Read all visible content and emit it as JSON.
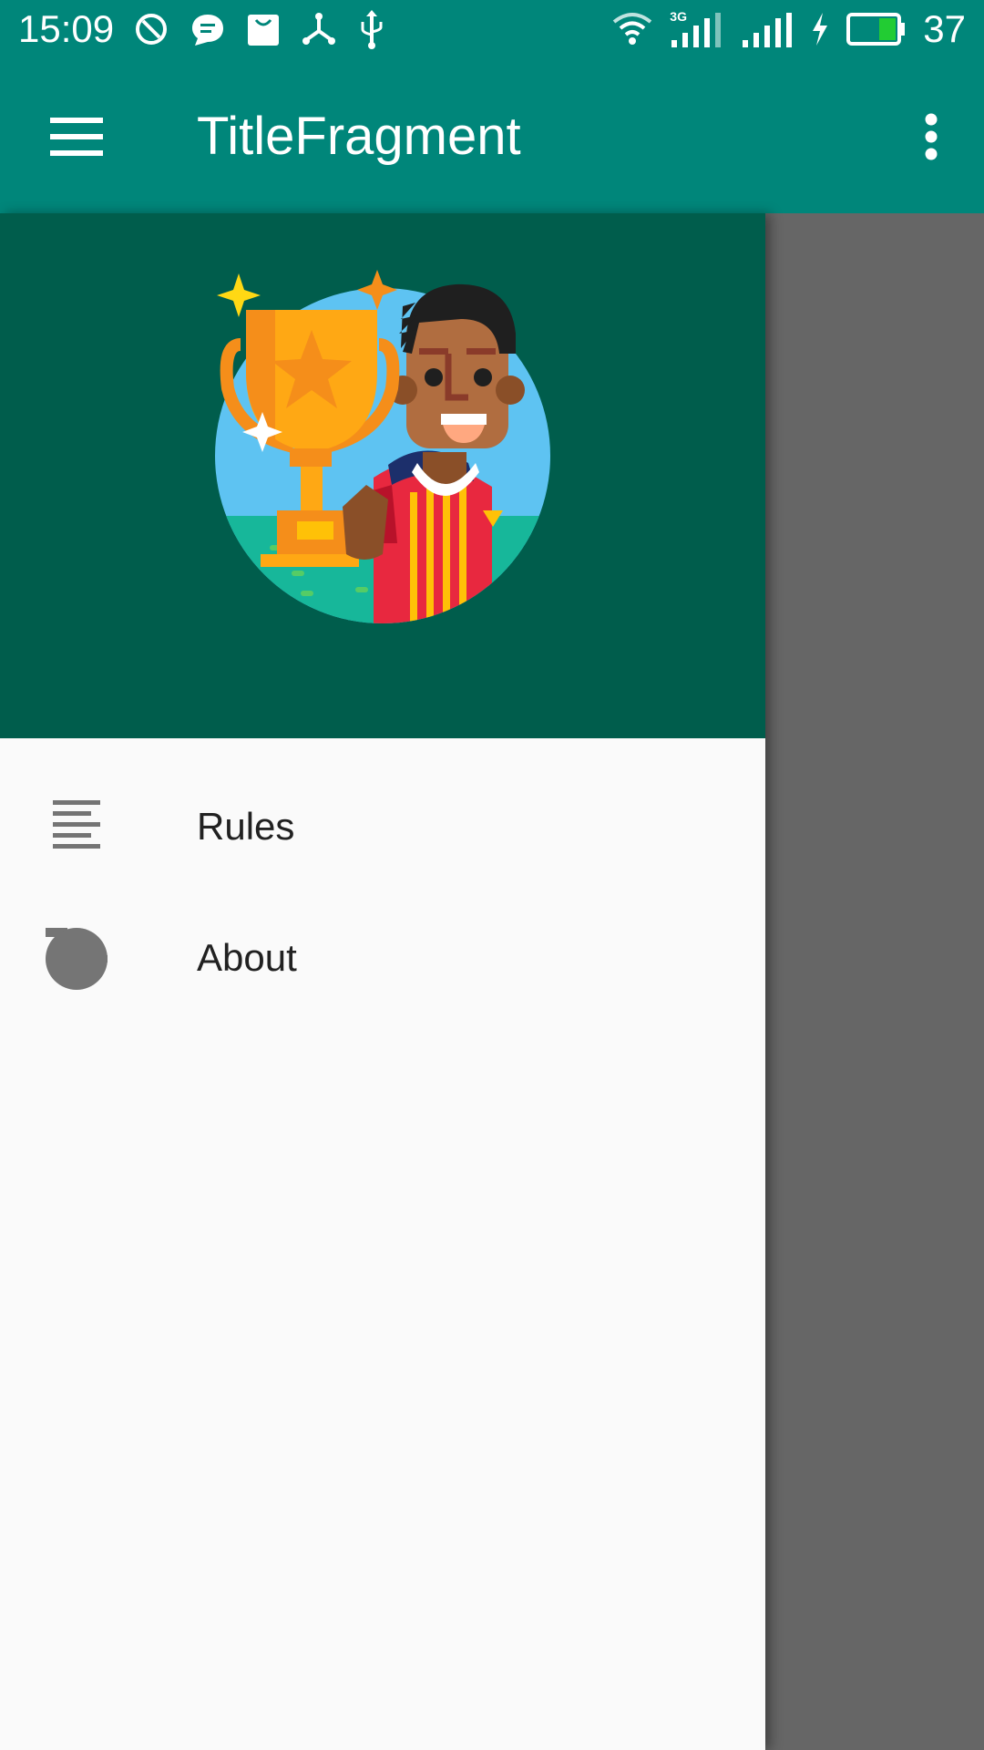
{
  "status_bar": {
    "time": "15:09",
    "battery_level": "37",
    "network_type": "3G",
    "left_icons": [
      "blocked-icon",
      "chat-bubble-icon",
      "shopping-bag-icon",
      "share-nodes-icon",
      "usb-icon"
    ],
    "right_icons": [
      "wifi-icon",
      "signal-3g-icon",
      "signal-icon",
      "charging-icon",
      "battery-icon"
    ],
    "background_color": "#00867a"
  },
  "app_bar": {
    "title": "TitleFragment",
    "background_color": "#00867a",
    "navigation_icon": "hamburger-menu-icon",
    "action_icon": "overflow-menu-icon"
  },
  "drawer": {
    "header_background_color": "#005d4c",
    "header_image": "trophy-player-illustration",
    "items": [
      {
        "label": "Rules",
        "icon": "rules-list-icon"
      },
      {
        "label": "About",
        "icon": "about-icon"
      }
    ]
  },
  "scrim_color": "#666666"
}
